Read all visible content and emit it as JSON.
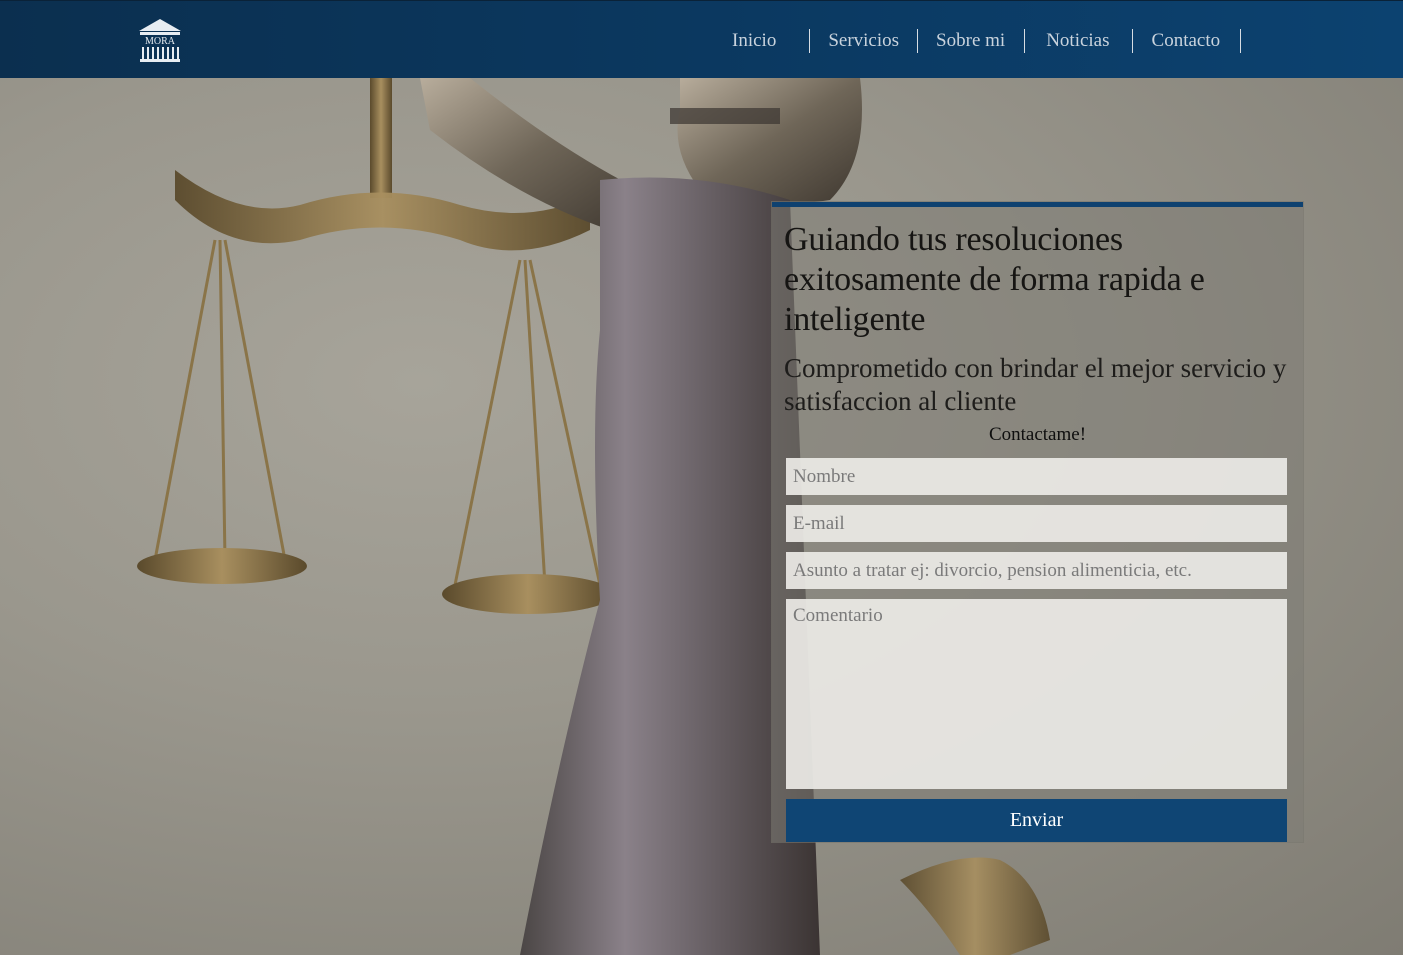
{
  "brand": {
    "logo_text": "MORA"
  },
  "nav": {
    "items": [
      {
        "label": "Inicio"
      },
      {
        "label": "Servicios"
      },
      {
        "label": "Sobre mi"
      },
      {
        "label": "Noticias"
      },
      {
        "label": "Contacto"
      }
    ]
  },
  "hero": {
    "image_subject": "Lady Justice statue holding scales"
  },
  "contact_card": {
    "title": "Guiando tus resoluciones exitosamente de forma rapida e inteligente",
    "subtitle": "Comprometido con brindar el mejor servicio y satisfaccion al cliente",
    "cta": "Contactame!",
    "fields": {
      "name_placeholder": "Nombre",
      "email_placeholder": "E-mail",
      "subject_placeholder": "Asunto a tratar ej: divorcio, pension alimenticia, etc.",
      "comment_placeholder": "Comentario"
    },
    "submit_label": "Enviar"
  },
  "colors": {
    "navbar": "#0b3a63",
    "accent": "#0f4574",
    "nav_text": "#c9d3dd"
  }
}
